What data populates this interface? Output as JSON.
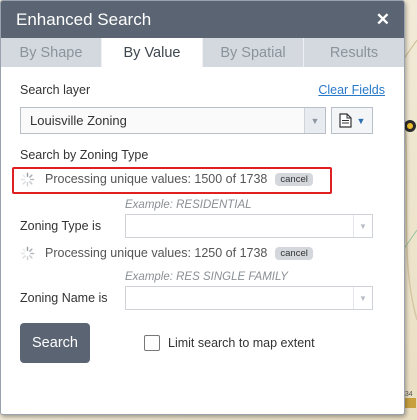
{
  "window": {
    "title": "Enhanced Search"
  },
  "tabs": [
    {
      "label": "By Shape",
      "active": false
    },
    {
      "label": "By Value",
      "active": true
    },
    {
      "label": "By Spatial",
      "active": false
    },
    {
      "label": "Results",
      "active": false
    }
  ],
  "search_layer": {
    "label": "Search layer",
    "clear_link": "Clear Fields",
    "selected": "Louisville Zoning"
  },
  "search_by": {
    "label": "Search by Zoning Type"
  },
  "processing_1": {
    "text": "Processing unique values: 1500 of 1738",
    "cancel": "cancel"
  },
  "zoning_type": {
    "example": "Example: RESIDENTIAL",
    "label": "Zoning Type is",
    "value": ""
  },
  "processing_2": {
    "text": "Processing unique values: 1250 of 1738",
    "cancel": "cancel"
  },
  "zoning_name": {
    "example": "Example: RES SINGLE FAMILY",
    "label": "Zoning Name is",
    "value": ""
  },
  "actions": {
    "search_label": "Search",
    "limit_label": "Limit search to map extent",
    "limit_checked": false
  },
  "map": {
    "visible_label": "934"
  },
  "colors": {
    "header": "#5a6472",
    "link": "#2979c8",
    "highlight": "#e02020"
  }
}
